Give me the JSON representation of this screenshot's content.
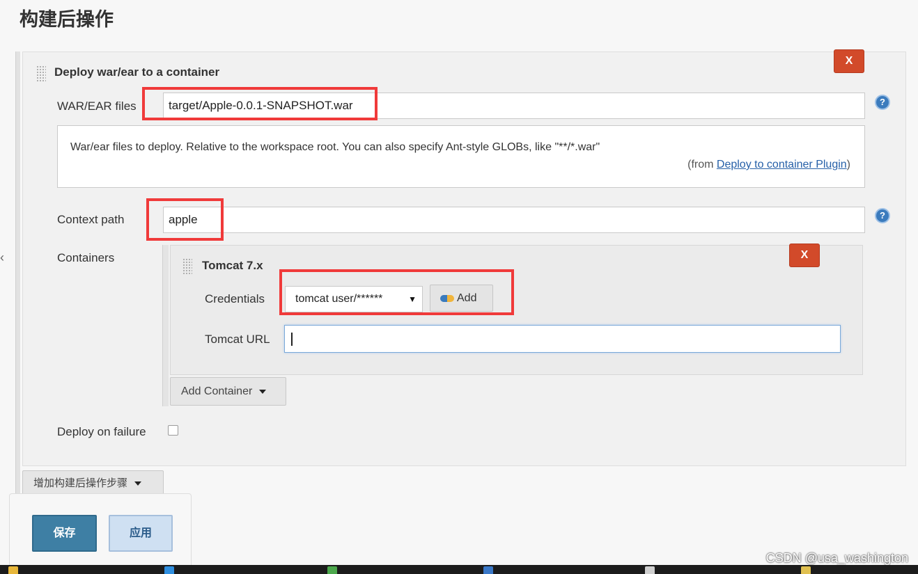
{
  "section": {
    "title": "构建后操作"
  },
  "step": {
    "title": "Deploy war/ear to a container",
    "delete_label": "X",
    "war_files": {
      "label": "WAR/EAR files",
      "value": "target/Apple-0.0.1-SNAPSHOT.war"
    },
    "help": {
      "text": "War/ear files to deploy. Relative to the workspace root. You can also specify Ant-style GLOBs, like \"**/*.war\"",
      "from_prefix": "(from ",
      "link_text": "Deploy to container Plugin",
      "from_suffix": ")"
    },
    "context_path": {
      "label": "Context path",
      "value": "apple"
    },
    "containers": {
      "label": "Containers",
      "item": {
        "title": "Tomcat 7.x",
        "delete_label": "X",
        "credentials_label": "Credentials",
        "credentials_value": "tomcat  user/******",
        "add_label": "Add",
        "url_label": "Tomcat URL",
        "url_value": ""
      },
      "add_container_label": "Add Container"
    },
    "deploy_on_failure_label": "Deploy on failure"
  },
  "add_post_build_label": "增加构建后操作步骤",
  "actions": {
    "save_label": "保存",
    "apply_label": "应用"
  },
  "watermark": "CSDN @usa_washington",
  "colors": {
    "highlight": "#f03a3a",
    "delete": "#d24a2a",
    "save": "#3e7fa4",
    "link": "#2660a8"
  },
  "icons": [
    "grip-icon",
    "help-icon",
    "key-icon",
    "chevron-down-icon"
  ]
}
